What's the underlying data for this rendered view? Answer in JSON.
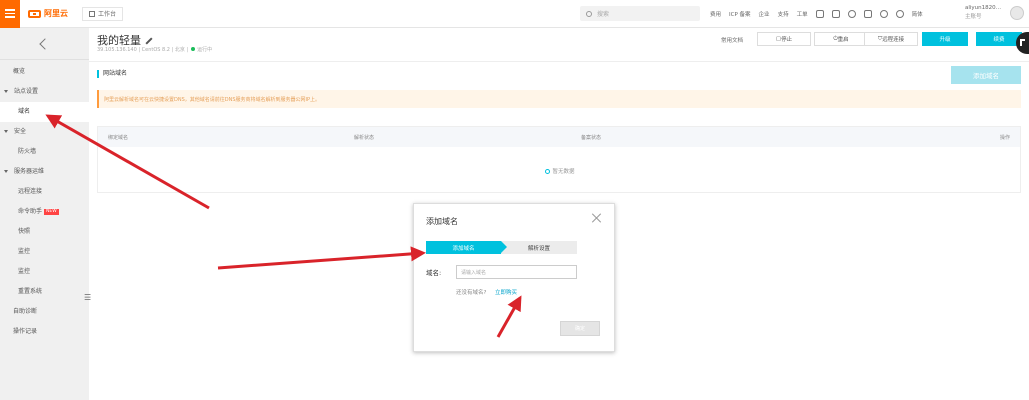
{
  "topbar": {
    "logo_text": "阿里云",
    "workspace": "工作台",
    "search_placeholder": "搜索",
    "nav": [
      "费用",
      "ICP 备案",
      "企业",
      "支持",
      "工单"
    ],
    "lang": "简体",
    "username": "aliyun1820…",
    "user_sub": "主账号"
  },
  "sidebar": {
    "items": [
      {
        "label": "概览",
        "kind": "top"
      },
      {
        "label": "站点设置",
        "kind": "group"
      },
      {
        "label": "域名",
        "kind": "sub",
        "active": true
      },
      {
        "label": "安全",
        "kind": "group"
      },
      {
        "label": "防火墙",
        "kind": "sub"
      },
      {
        "label": "服务器运维",
        "kind": "group"
      },
      {
        "label": "远程连接",
        "kind": "sub"
      },
      {
        "label": "命令助手",
        "kind": "sub",
        "badge": "NEW"
      },
      {
        "label": "快照",
        "kind": "sub"
      },
      {
        "label": "监控",
        "kind": "sub"
      },
      {
        "label": "监控",
        "kind": "sub"
      },
      {
        "label": "重置系统",
        "kind": "sub"
      },
      {
        "label": "自助诊断",
        "kind": "top"
      },
      {
        "label": "操作记录",
        "kind": "top"
      }
    ]
  },
  "header": {
    "title": "我的轻量",
    "meta": "39.105.136.140 | CentOS 8.2 | 北京 |",
    "status": "运行中",
    "doc": "常用文档",
    "stop": "停止",
    "restart": "重启",
    "remote": "远程连接",
    "upgrade": "升级",
    "renew": "续费"
  },
  "domain_section": {
    "title": "网站域名",
    "add_button": "添加域名",
    "notice": "阿里云解析域名可在云快捷设置DNS，其他域名请前往DNS服务商将域名解析到服务器公网IP上。",
    "columns": [
      "绑定域名",
      "解析状态",
      "备案状态",
      "操作"
    ],
    "empty": "暂无数据"
  },
  "dialog": {
    "title": "添加域名",
    "step1": "添加域名",
    "step2": "解析设置",
    "field_label": "域名:",
    "field_placeholder": "请输入域名",
    "hint": "还没有域名?",
    "buy_link": "立即购买",
    "confirm": "确定"
  },
  "colors": {
    "brand": "#ff6a00",
    "accent": "#00c1de",
    "annotation": "#d9232a"
  }
}
